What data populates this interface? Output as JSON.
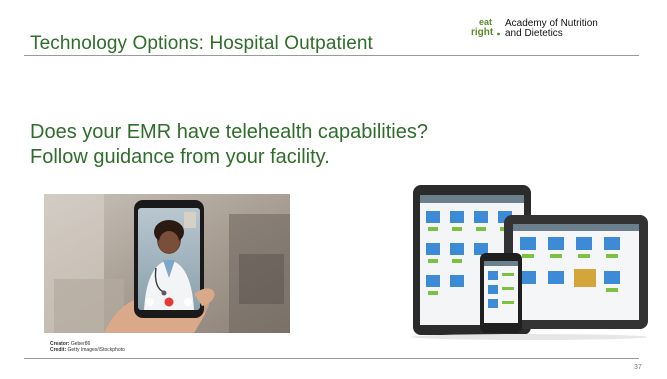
{
  "slide": {
    "title": "Technology Options: Hospital Outpatient",
    "logo": {
      "mark_line1": "eat",
      "mark_line2": "right.",
      "org_line1": "Academy of Nutrition",
      "org_line2": "and Dietetics"
    },
    "body": {
      "line1": "Does your EMR have telehealth capabilities?",
      "line2": "Follow guidance from your facility."
    },
    "credits": {
      "creator_label": "Creator:",
      "creator_value": "Geber86",
      "credit_label": "Credit:",
      "credit_value": "Getty Images/iStockphoto"
    },
    "page_number": "37"
  },
  "colors": {
    "title_green": "#2f6d2b",
    "logo_green": "#5c8a2c",
    "rule_gray": "#9a9a9a"
  }
}
